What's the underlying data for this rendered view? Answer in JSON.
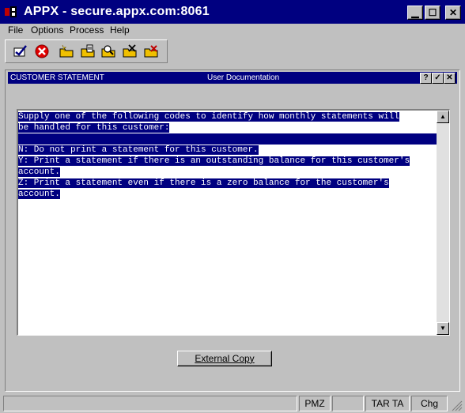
{
  "window": {
    "title": "APPX - secure.appx.com:8061",
    "controls": {
      "minimize": "▁",
      "maximize": "☐",
      "close": "✕"
    }
  },
  "menubar": [
    "File",
    "Options",
    "Process",
    "Help"
  ],
  "toolbar": [
    {
      "icon": "checkmark-icon"
    },
    {
      "icon": "cancel-icon"
    },
    {
      "icon": "add-record-icon"
    },
    {
      "icon": "change-record-icon"
    },
    {
      "icon": "inquire-record-icon"
    },
    {
      "icon": "delete-record-icon"
    },
    {
      "icon": "scan-record-icon"
    }
  ],
  "subwindow": {
    "left_title": "CUSTOMER STATEMENT",
    "center_title": "User Documentation",
    "controls": {
      "help": "?",
      "ok": "✓",
      "close": "✕"
    }
  },
  "document": {
    "lines": [
      "Supply one of the following codes to identify how monthly statements will",
      "be handled for this customer:",
      "",
      "N: Do not print a statement for this customer.",
      "Y: Print a statement if there is an outstanding balance for this customer's",
      "account.",
      "Z: Print a statement even if there is a zero balance for the customer's",
      "account."
    ]
  },
  "scrollbar": {
    "up": "▲",
    "down": "▼"
  },
  "buttons": {
    "external_copy": "External Copy"
  },
  "statusbar": {
    "panel1": "PMZ",
    "panel2": "",
    "panel3": "TAR TA",
    "panel4": "Chg"
  },
  "colors": {
    "title_bg": "#000080",
    "selection_bg": "#000080",
    "face": "#c0c0c0"
  }
}
